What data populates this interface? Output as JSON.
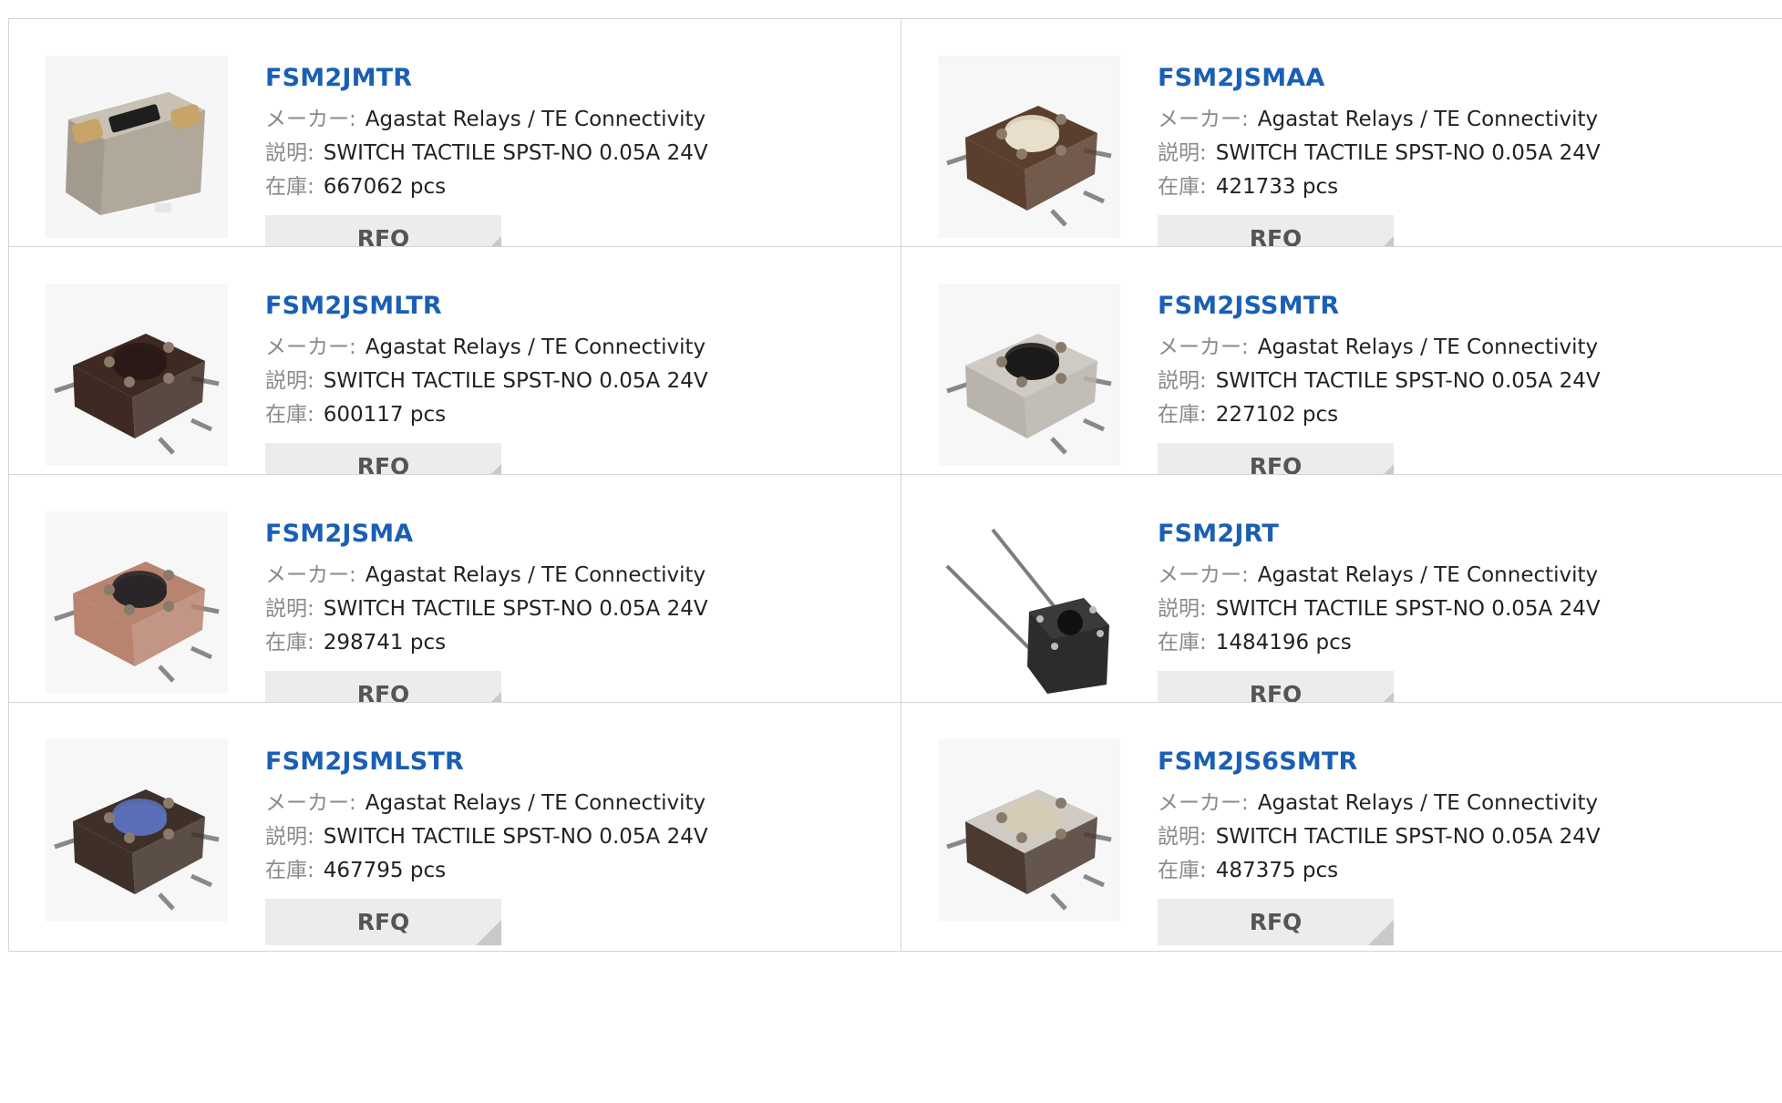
{
  "labels": {
    "maker": "メーカー:",
    "description": "説明:",
    "stock": "在庫:",
    "rfq": "RFQ"
  },
  "products": [
    {
      "part": "FSM2JMTR",
      "maker": "Agastat Relays / TE Connectivity",
      "description": "SWITCH TACTILE SPST-NO 0.05A 24V",
      "stock": "667062 pcs",
      "image": "side-switch-image"
    },
    {
      "part": "FSM2JSMAA",
      "maker": "Agastat Relays / TE Connectivity",
      "description": "SWITCH TACTILE SPST-NO 0.05A 24V",
      "stock": "421733 pcs",
      "image": "tactile-switch-cream-image"
    },
    {
      "part": "FSM2JSMLTR",
      "maker": "Agastat Relays / TE Connectivity",
      "description": "SWITCH TACTILE SPST-NO 0.05A 24V",
      "stock": "600117 pcs",
      "image": "tactile-switch-dark-image"
    },
    {
      "part": "FSM2JSSMTR",
      "maker": "Agastat Relays / TE Connectivity",
      "description": "SWITCH TACTILE SPST-NO 0.05A 24V",
      "stock": "227102 pcs",
      "image": "tactile-switch-metal-image"
    },
    {
      "part": "FSM2JSMA",
      "maker": "Agastat Relays / TE Connectivity",
      "description": "SWITCH TACTILE SPST-NO 0.05A 24V",
      "stock": "298741 pcs",
      "image": "tactile-switch-copper-image"
    },
    {
      "part": "FSM2JRT",
      "maker": "Agastat Relays / TE Connectivity",
      "description": "SWITCH TACTILE SPST-NO 0.05A 24V",
      "stock": "1484196 pcs",
      "image": "tactile-switch-through-hole-image"
    },
    {
      "part": "FSM2JSMLSTR",
      "maker": "Agastat Relays / TE Connectivity",
      "description": "SWITCH TACTILE SPST-NO 0.05A 24V",
      "stock": "467795 pcs",
      "image": "tactile-switch-blue-image"
    },
    {
      "part": "FSM2JS6SMTR",
      "maker": "Agastat Relays / TE Connectivity",
      "description": "SWITCH TACTILE SPST-NO 0.05A 24V",
      "stock": "487375 pcs",
      "image": "tactile-switch-beige-image"
    }
  ]
}
